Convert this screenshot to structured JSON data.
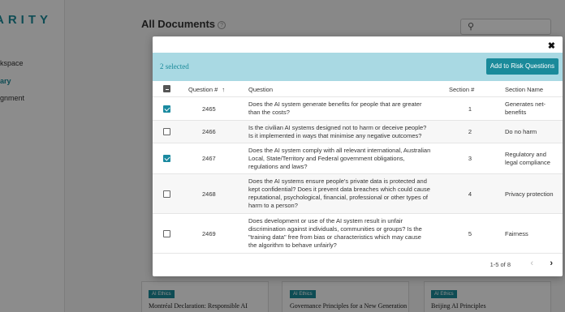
{
  "app": {
    "brand": "ARITY",
    "sidebar_items": [
      "kspace",
      "ary",
      "gnment"
    ],
    "page_title": "All Documents",
    "help_glyph": "?",
    "bg_cards": [
      {
        "badge": "AI Ethics",
        "title": "Montréal Declaration: Responsible AI"
      },
      {
        "badge": "AI Ethics",
        "title": "Governance Principles for a New Generation"
      },
      {
        "badge": "AI Ethics",
        "title": "Beijing AI Principles"
      }
    ]
  },
  "modal": {
    "close_glyph": "✖",
    "selected_text": "2 selected",
    "add_button": "Add to Risk Questions",
    "columns": {
      "question_no": "Question #",
      "sort_glyph": "↑",
      "question": "Question",
      "section_no": "Section #",
      "section_name": "Section Name"
    },
    "rows": [
      {
        "checked": true,
        "id": "2465",
        "question": "Does the AI system generate benefits for people that are greater than the costs?",
        "section": "1",
        "name": "Generates net-benefits"
      },
      {
        "checked": false,
        "id": "2466",
        "question": "Is the civilian AI systems designed not to harm or deceive people? Is it implemented in ways that minimise any negative outcomes?",
        "section": "2",
        "name": "Do no harm"
      },
      {
        "checked": true,
        "id": "2467",
        "question": "Does the AI system comply with all relevant international, Australian Local, State/Territory and Federal government obligations, regulations and laws?",
        "section": "3",
        "name": "Regulatory and legal compliance"
      },
      {
        "checked": false,
        "id": "2468",
        "question": "Does the AI systems ensure people's private data is protected and kept confidential? Does it prevent data breaches which could cause reputational, psychological, financial, professional or other types of harm to a person?",
        "section": "4",
        "name": "Privacy protection"
      },
      {
        "checked": false,
        "id": "2469",
        "question": "Does development or use of the AI system result in unfair discrimination against individuals, communities or groups? Is the \"training data\" free from bias or characteristics which may cause the algorithm to behave unfairly?",
        "section": "5",
        "name": "Fairness"
      }
    ],
    "pagination": "1-5 of 8",
    "prev_glyph": "‹",
    "next_glyph": "›"
  }
}
